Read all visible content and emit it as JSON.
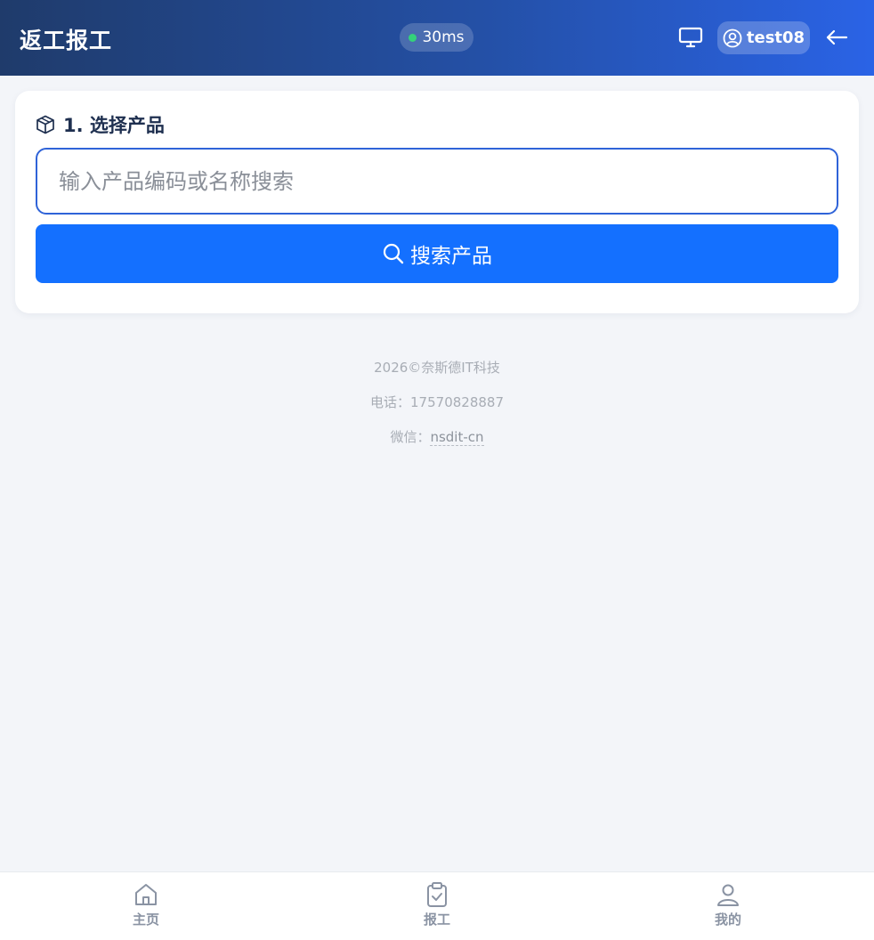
{
  "header": {
    "title": "返工报工",
    "latency": "30ms",
    "username": "test08",
    "icons": {
      "monitor": "monitor-icon",
      "user": "user-circle-icon",
      "back": "arrow-left-icon"
    }
  },
  "product_section": {
    "title": "1. 选择产品",
    "icon": "box-icon",
    "search_placeholder": "输入产品编码或名称搜索",
    "search_value": "",
    "search_button_label": "搜索产品"
  },
  "footer": {
    "copyright": "2026©奈斯德IT科技",
    "phone_label": "电话：",
    "phone": "17570828887",
    "wechat_label": "微信：",
    "wechat": "nsdit-cn"
  },
  "bottom_nav": [
    {
      "label": "主页",
      "icon": "home-icon"
    },
    {
      "label": "报工",
      "icon": "clipboard-check-icon"
    },
    {
      "label": "我的",
      "icon": "user-icon"
    }
  ],
  "colors": {
    "primary": "#1470ff",
    "header_start": "#1f3b6b",
    "header_end": "#2a63e6",
    "status_ok": "#34d27a"
  }
}
